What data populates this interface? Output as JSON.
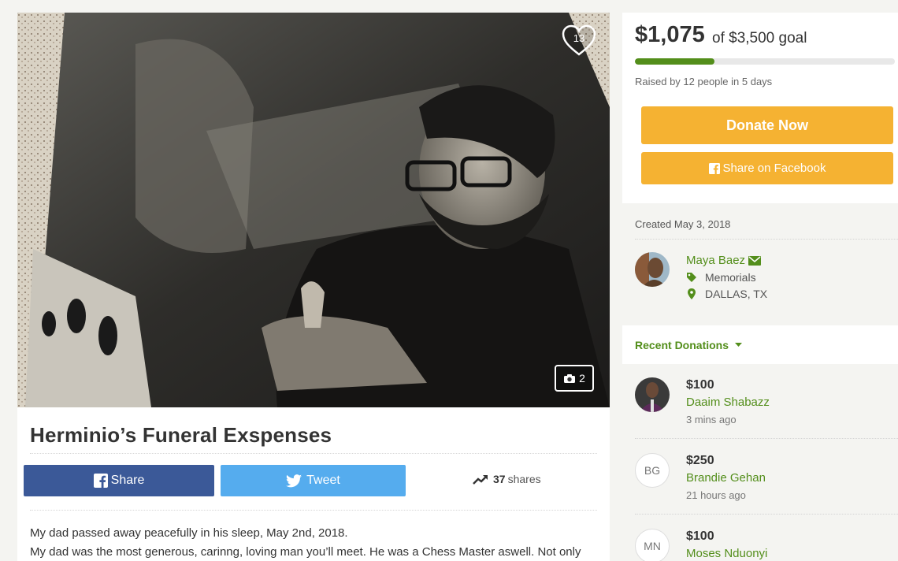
{
  "hero": {
    "heart_count": "13",
    "photo_count": "2",
    "icons": {
      "heart": "heart-icon",
      "camera": "camera-icon"
    }
  },
  "campaign": {
    "title": "Herminio’s Funeral Exspenses",
    "share_label": "Share",
    "tweet_label": "Tweet",
    "shares_count": "37",
    "shares_label": "shares",
    "story": [
      "My dad passed away peacefully in his sleep, May 2nd, 2018.",
      "My dad was the most generous, carinng, loving man you’ll meet. He was a Chess Master aswell. Not only"
    ]
  },
  "summary": {
    "raised_amount": "$1,075",
    "goal_text": "of $3,500 goal",
    "progress_fraction": 0.307,
    "raised_by": "Raised by 12 people in 5 days",
    "donate_label": "Donate Now",
    "facebook_label": "Share on Facebook"
  },
  "organizer": {
    "created": "Created May 3, 2018",
    "name": "Maya Baez",
    "category": "Memorials",
    "location": "DALLAS, TX"
  },
  "recent_donations": {
    "heading": "Recent Donations",
    "items": [
      {
        "amount": "$100",
        "name": "Daaim Shabazz",
        "time": "3 mins ago",
        "initials": ""
      },
      {
        "amount": "$250",
        "name": "Brandie Gehan",
        "time": "21 hours ago",
        "initials": "BG"
      },
      {
        "amount": "$100",
        "name": "Moses Nduonyi",
        "time": "",
        "initials": "MN"
      }
    ]
  },
  "colors": {
    "brand_green": "#538e1b",
    "donate_orange": "#f5b232",
    "facebook_blue": "#3b5998",
    "twitter_blue": "#55acee"
  }
}
